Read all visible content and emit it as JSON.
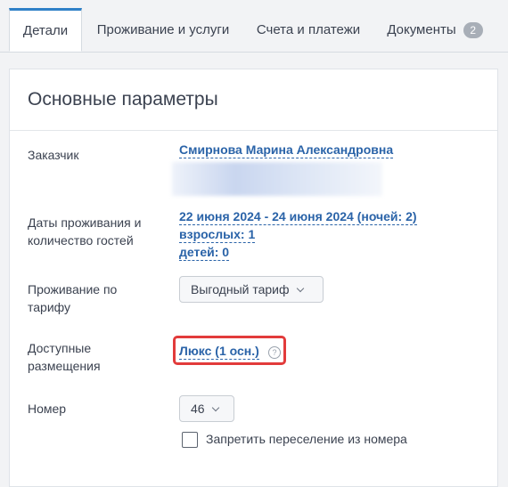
{
  "tabs": [
    {
      "label": "Детали",
      "active": true
    },
    {
      "label": "Проживание и услуги",
      "active": false
    },
    {
      "label": "Счета и платежи",
      "active": false
    },
    {
      "label": "Документы",
      "active": false,
      "badge": "2"
    }
  ],
  "section": {
    "title": "Основные параметры"
  },
  "fields": {
    "customer": {
      "label": "Заказчик",
      "value": "Смирнова Марина Александровна"
    },
    "dates": {
      "label": "Даты проживания и количество гостей",
      "dates_value": "22 июня 2024 - 24 июня 2024 (ночей: 2)",
      "adults_value": "взрослых: 1",
      "children_value": "детей: 0"
    },
    "tariff": {
      "label": "Проживание по тарифу",
      "value": "Выгодный тариф"
    },
    "accommodation": {
      "label": "Доступные размещения",
      "value": "Люкс (1 осн.)",
      "help_glyph": "?"
    },
    "room": {
      "label": "Номер",
      "value": "46",
      "forbid_checkbox_label": "Запретить переселение из номера",
      "forbid_checked": false
    }
  },
  "colors": {
    "accent": "#2f80c7",
    "link": "#2a63a8",
    "highlight": "#e23b3b"
  }
}
